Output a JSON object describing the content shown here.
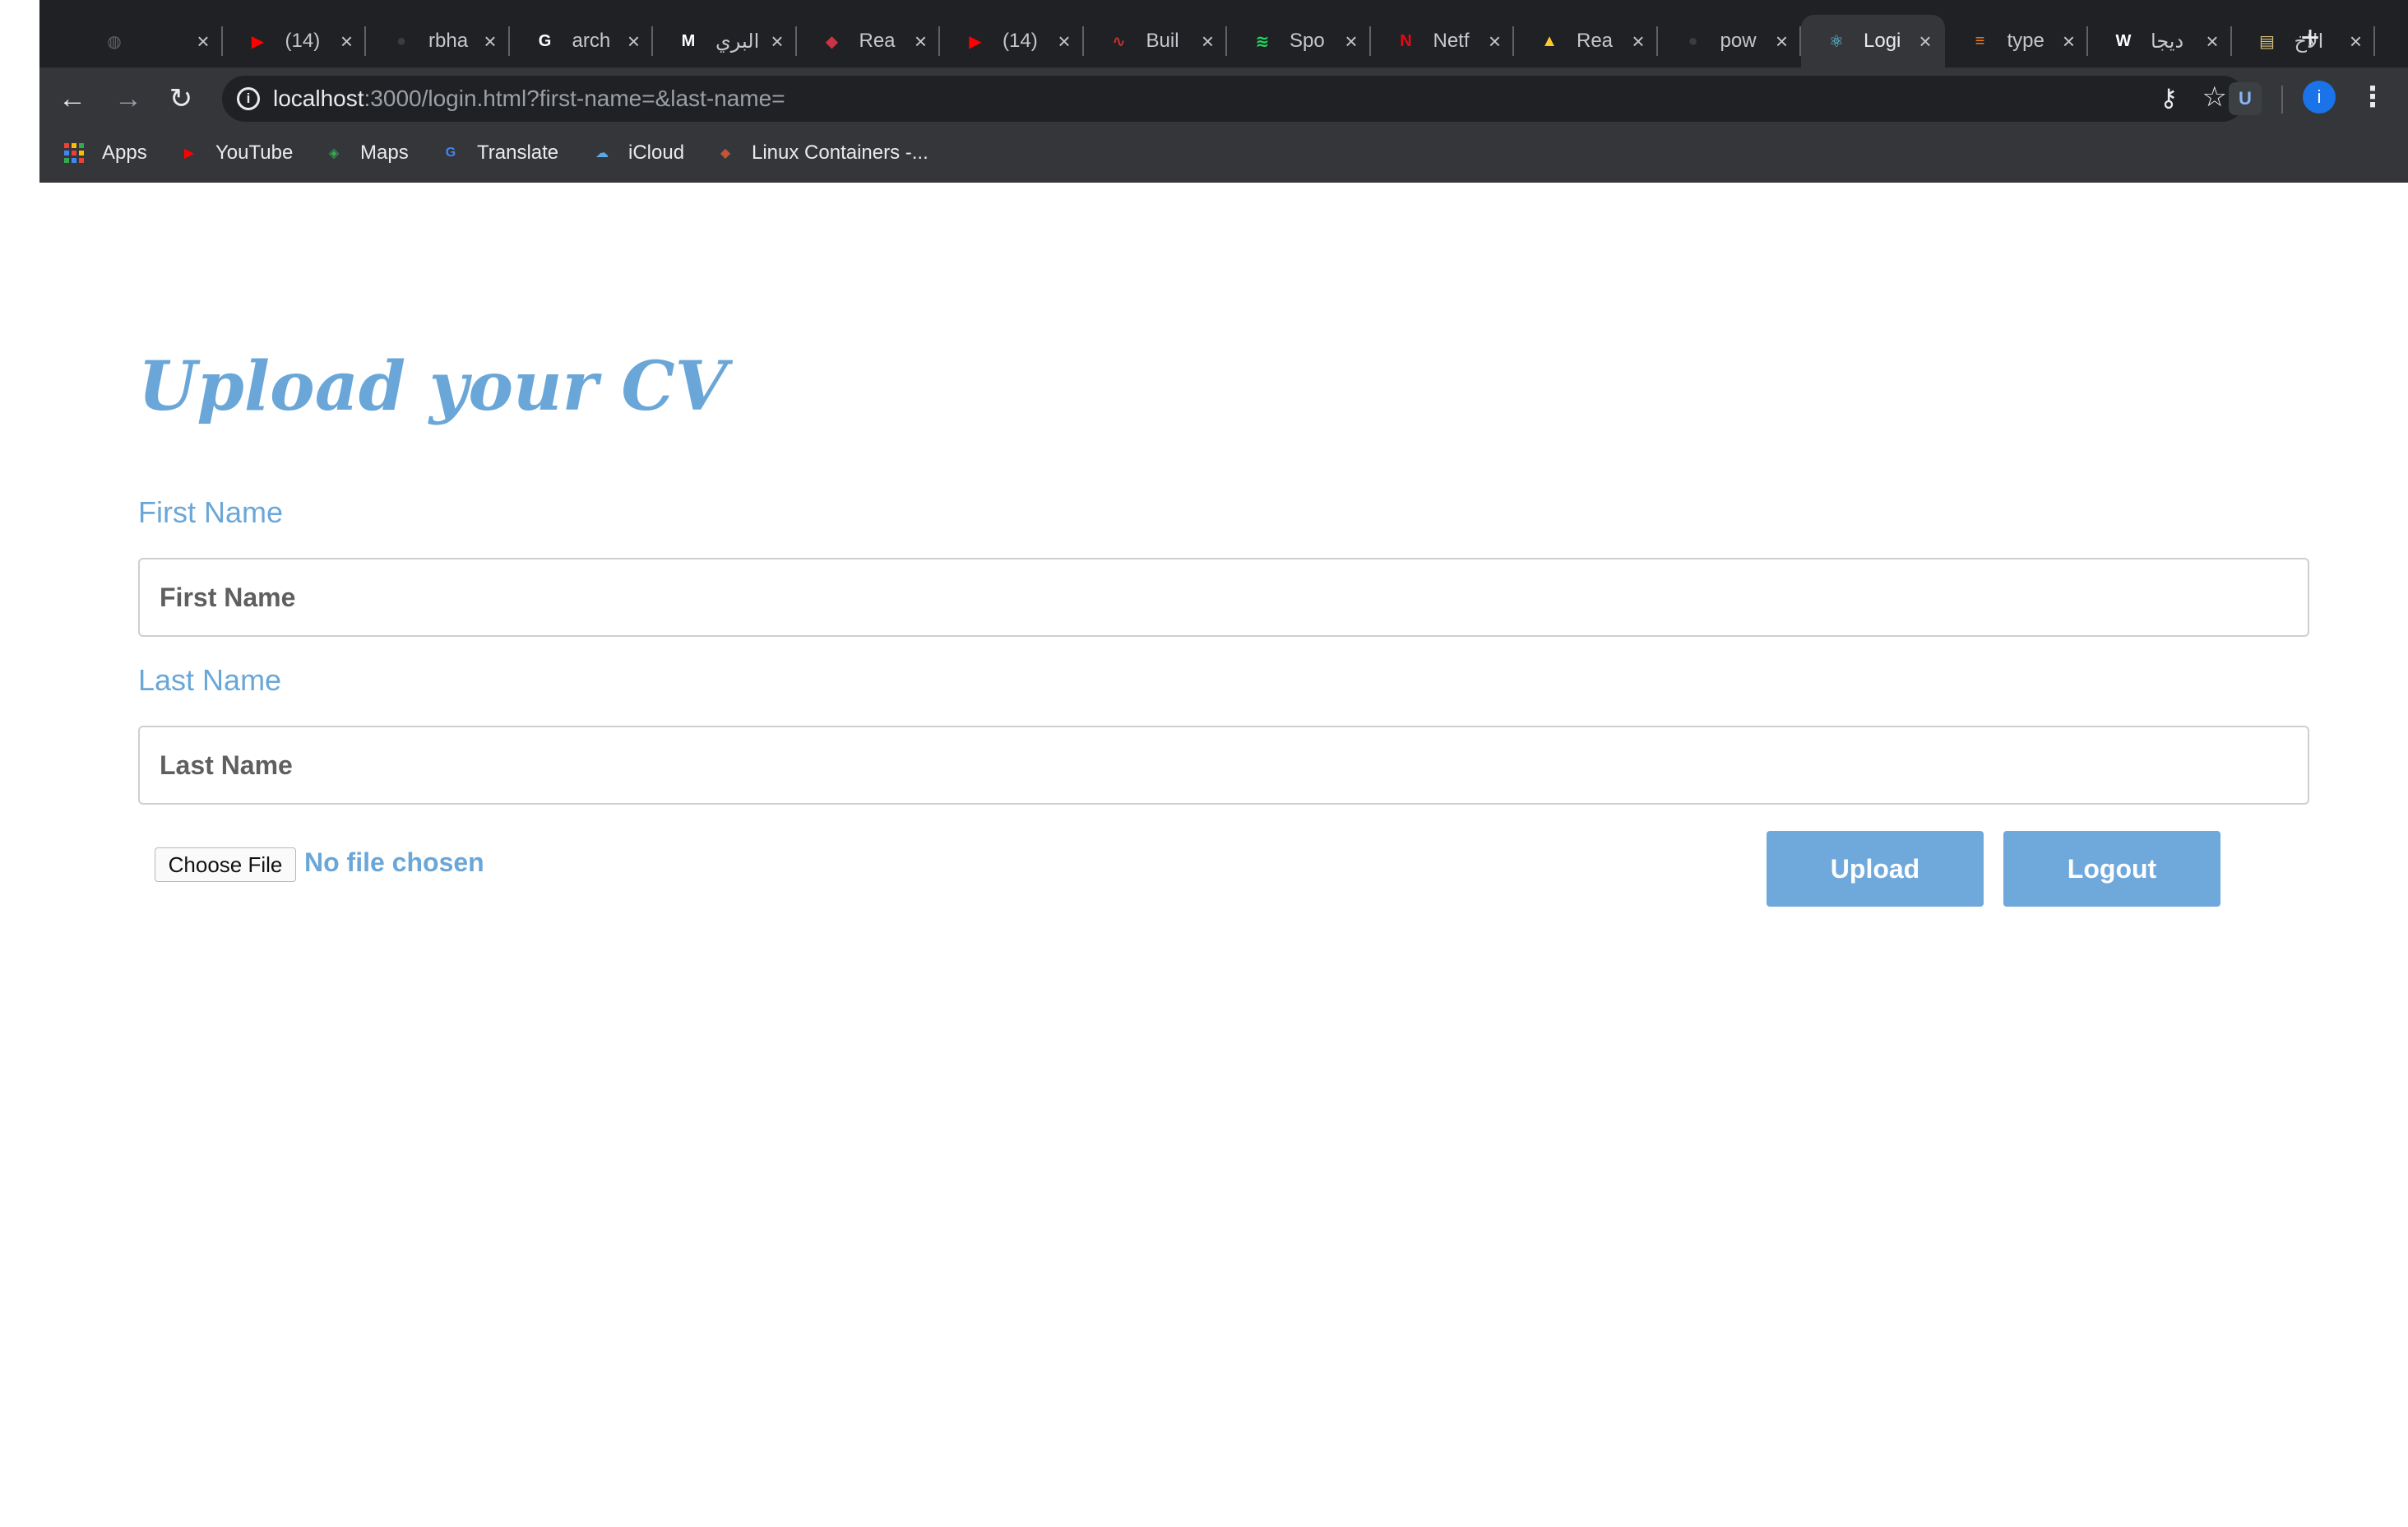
{
  "browser": {
    "tabs": [
      {
        "title": "",
        "icon": "globe-icon",
        "color": "#5f6368"
      },
      {
        "title": "(14)",
        "icon": "youtube-icon",
        "color": "#ff0000"
      },
      {
        "title": "rbha",
        "icon": "github-icon",
        "color": "#3c3c3c"
      },
      {
        "title": "arch",
        "icon": "google-icon",
        "color": "#ffffff"
      },
      {
        "title": "البري",
        "icon": "gmail-icon",
        "color": "#ffffff"
      },
      {
        "title": "Rea",
        "icon": "ruby-gem-icon",
        "color": "#cc3344"
      },
      {
        "title": "(14)",
        "icon": "youtube-icon",
        "color": "#ff0000"
      },
      {
        "title": "Buil",
        "icon": "redux-icon",
        "color": "#c4302b"
      },
      {
        "title": "Spo",
        "icon": "spotify-icon",
        "color": "#1ed760"
      },
      {
        "title": "Netf",
        "icon": "netflix-icon",
        "color": "#e50914"
      },
      {
        "title": "Rea",
        "icon": "firebase-icon",
        "color": "#ffca28"
      },
      {
        "title": "pow",
        "icon": "github-icon",
        "color": "#3c3c3c"
      },
      {
        "title": "Logi",
        "icon": "react-icon",
        "color": "#61dafb",
        "active": true
      },
      {
        "title": "type",
        "icon": "stackoverflow-icon",
        "color": "#f48024"
      },
      {
        "title": "ديجا",
        "icon": "wikipedia-icon",
        "color": "#ffffff"
      },
      {
        "title": "الاخ",
        "icon": "news-site-icon",
        "color": "#d9c27a"
      }
    ],
    "url_host": "localhost",
    "url_rest": ":3000/login.html?first-name=&last-name=",
    "ext_label": "U",
    "profile_initial": "i",
    "bookmarks": [
      {
        "label": "Apps",
        "icon": "apps-grid-icon"
      },
      {
        "label": "YouTube",
        "icon": "youtube-icon",
        "color": "#ff0000"
      },
      {
        "label": "Maps",
        "icon": "maps-icon",
        "color": "#34a853"
      },
      {
        "label": "Translate",
        "icon": "translate-icon",
        "color": "#4285f4"
      },
      {
        "label": "iCloud",
        "icon": "icloud-icon",
        "color": "#5aa9e6"
      },
      {
        "label": "Linux Containers -...",
        "icon": "linux-containers-icon",
        "color": "#c0553a"
      }
    ]
  },
  "form": {
    "title": "Upload your CV",
    "first_name_label": "First Name",
    "first_name_placeholder": "First Name",
    "last_name_label": "Last Name",
    "last_name_placeholder": "Last Name",
    "file_button": "Choose File",
    "file_status": "No file chosen",
    "upload_label": "Upload",
    "logout_label": "Logout"
  },
  "colors": {
    "accent": "#6aa7d8",
    "button": "#6fa9dc",
    "chrome_dark": "#202124",
    "chrome_toolbar": "#35363a"
  }
}
